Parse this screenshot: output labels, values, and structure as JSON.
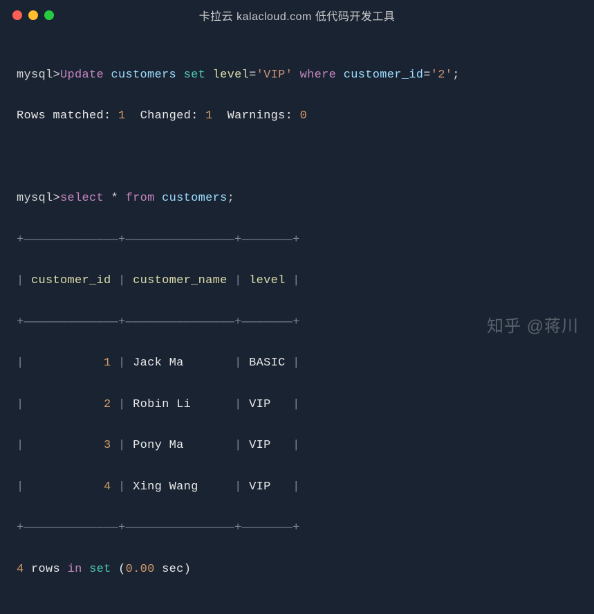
{
  "titlebar": {
    "title": "卡拉云 kalacloud.com 低代码开发工具"
  },
  "line1": {
    "prompt": "mysql>",
    "kw_update": "Update",
    "table": "customers",
    "kw_set": "set",
    "col_level": "level",
    "eq1": "=",
    "val_vip": "'VIP'",
    "kw_where": "where",
    "col_cid": "customer_id",
    "eq2": "=",
    "val_2": "'2'",
    "semi": ";"
  },
  "line2": {
    "rows_matched_label": "Rows matched:",
    "rows_matched_val": "1",
    "changed_label": "Changed:",
    "changed_val": "1",
    "warnings_label": "Warnings:",
    "warnings_val": "0"
  },
  "line3": {
    "prompt": "mysql>",
    "kw_select": "select",
    "star": "*",
    "kw_from": "from",
    "table": "customers",
    "semi": ";"
  },
  "table": {
    "border_top": "+—————————————+———————————————+———————+",
    "header_row": "| customer_id | customer_name | level |",
    "border_mid": "+—————————————+———————————————+———————+",
    "h1": "customer_id",
    "h2": "customer_name",
    "h3": "level",
    "rows": [
      {
        "id": "1",
        "name": "Jack Ma      ",
        "level": "BASIC"
      },
      {
        "id": "2",
        "name": "Robin Li     ",
        "level": "VIP  "
      },
      {
        "id": "3",
        "name": "Pony Ma      ",
        "level": "VIP  "
      },
      {
        "id": "4",
        "name": "Xing Wang    ",
        "level": "VIP  "
      }
    ],
    "border_bot": "+—————————————+———————————————+———————+"
  },
  "footer": {
    "count": "4",
    "text1": "rows",
    "text2": "in",
    "text3": "set",
    "paren_open": "(",
    "time": "0.00",
    "sec": "sec",
    "paren_close": ")"
  },
  "watermark": "知乎 @蒋川"
}
